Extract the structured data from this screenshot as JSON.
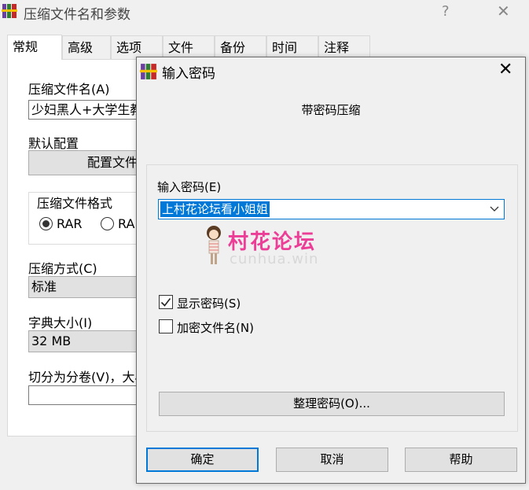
{
  "back_window": {
    "title": "压缩文件名和参数",
    "help": "?",
    "close": "✕",
    "tabs": [
      "常规",
      "高级",
      "选项",
      "文件",
      "备份",
      "时间",
      "注释"
    ],
    "archive_name_label": "压缩文件名(A)",
    "archive_name_value": "少妇黑人+大学生教",
    "profile_label": "默认配置",
    "profile_button": "配置文件",
    "format_label": "压缩文件格式",
    "format_rar": "RAR",
    "format_rar4": "RA",
    "method_label": "压缩方式(C)",
    "method_value": "标准",
    "dict_label": "字典大小(I)",
    "dict_value": "32 MB",
    "split_label": "切分为分卷(V)，大小"
  },
  "dialog": {
    "title": "输入密码",
    "close": "✕",
    "subtitle": "带密码压缩",
    "password_label": "输入密码(E)",
    "password_value": "上村花论坛看小姐姐",
    "show_password": {
      "label": "显示密码(S)",
      "checked": true
    },
    "encrypt_names": {
      "label": "加密文件名(N)",
      "checked": false
    },
    "organize_button": "整理密码(O)...",
    "ok_button": "确定",
    "cancel_button": "取消",
    "help_button": "帮助"
  },
  "watermark": {
    "text": "村花论坛",
    "sub": "cunhua.win"
  },
  "colors": {
    "accent": "#0078d7",
    "watermark": "#ec3d97"
  }
}
